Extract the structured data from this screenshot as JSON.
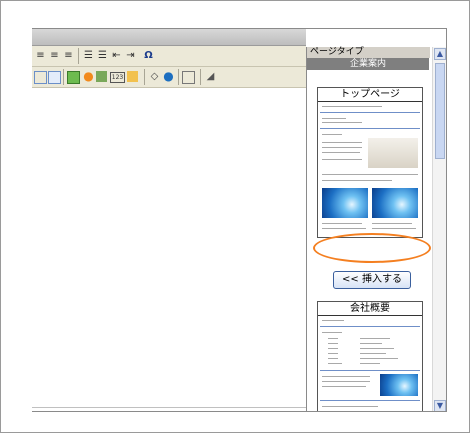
{
  "panel": {
    "title": "ページタイプ",
    "subtitle": "企業案内",
    "insert_button_label": "<< 挿入する"
  },
  "pages": [
    {
      "title": "トップページ"
    },
    {
      "title": "会社概要"
    }
  ],
  "colors": {
    "highlight_ring": "#f47f20",
    "panel_header": "#7f7f7f"
  },
  "toolbar_icons": [
    "align-center-icon",
    "align-right-icon",
    "justify-icon",
    "numbered-list-icon",
    "bulleted-list-icon",
    "outdent-icon",
    "indent-icon",
    "special-char-icon",
    "table-icon",
    "table-grid-icon",
    "insert-image-icon",
    "record-icon",
    "layers-icon",
    "field-icon",
    "form-icon",
    "source-icon",
    "globe-icon",
    "grid-icon",
    "eraser-icon"
  ]
}
